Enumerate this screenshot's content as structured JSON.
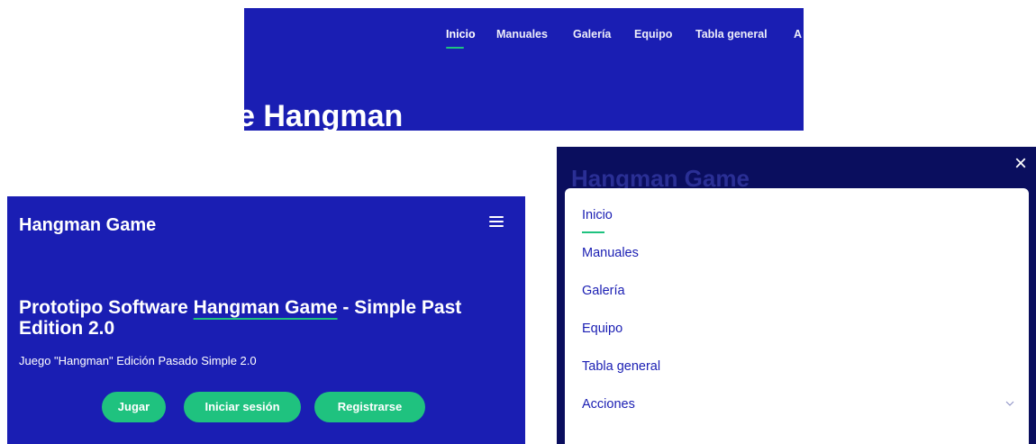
{
  "desktop": {
    "nav": [
      "Inicio",
      "Manuales",
      "Galería",
      "Equipo",
      "Tabla general",
      "A"
    ],
    "hero_title_fragment": "e Hangman"
  },
  "mobile": {
    "brand": "Hangman Game",
    "headline_pre": "Prototipo Software ",
    "headline_highlight": "Hangman Game",
    "headline_post": " - Simple Past Edition 2.0",
    "subtitle": "Juego \"Hangman\" Edición Pasado Simple 2.0",
    "buttons": [
      "Jugar",
      "Iniciar sesión",
      "Registrarse"
    ],
    "hamburger_icon": "hamburger-icon"
  },
  "menu": {
    "background_brand": "Hangman Game",
    "close_icon": "close-icon",
    "close_glyph": "×",
    "items": [
      "Inicio",
      "Manuales",
      "Galería",
      "Equipo",
      "Tabla general",
      "Acciones"
    ],
    "dropdown_icon": "chevron-down-icon"
  },
  "colors": {
    "brand_blue": "#1a1eb3",
    "accent_green": "#1fc27f",
    "overlay_navy": "#0a0e5e",
    "menu_text": "#1a1eb3"
  }
}
